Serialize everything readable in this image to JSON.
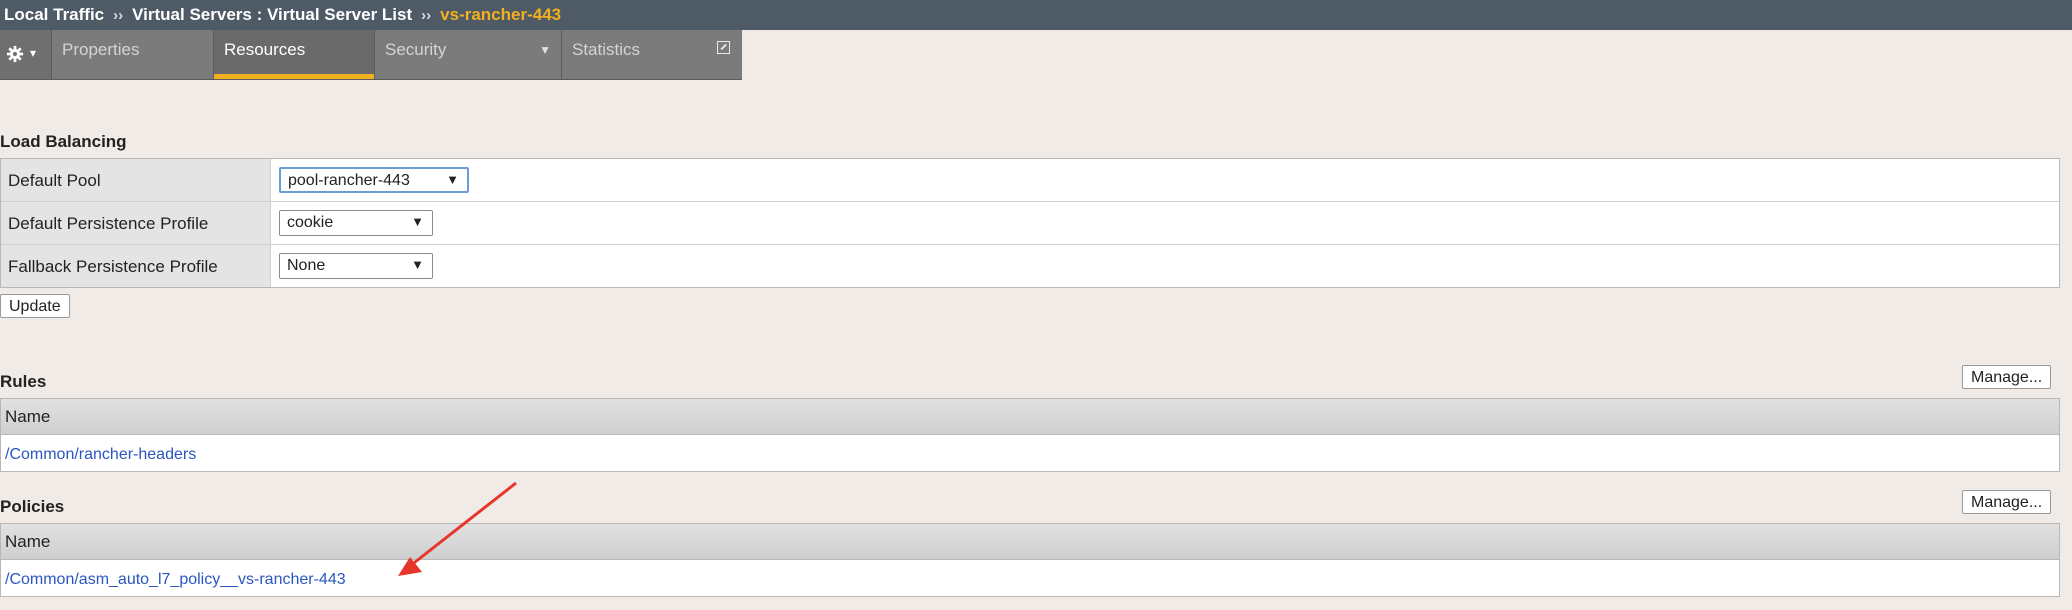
{
  "breadcrumb": {
    "items": [
      "Local Traffic",
      "Virtual Servers : Virtual Server List"
    ],
    "separator": "››",
    "current": "vs-rancher-443"
  },
  "tabs": [
    {
      "label": "Properties",
      "active": false
    },
    {
      "label": "Resources",
      "active": true
    },
    {
      "label": "Security",
      "active": false,
      "dropdown": true
    },
    {
      "label": "Statistics",
      "active": false,
      "popout": true
    }
  ],
  "load_balancing": {
    "title": "Load Balancing",
    "rows": [
      {
        "label": "Default Pool",
        "value": "pool-rancher-443"
      },
      {
        "label": "Default Persistence Profile",
        "value": "cookie"
      },
      {
        "label": "Fallback Persistence Profile",
        "value": "None"
      }
    ],
    "update_label": "Update"
  },
  "rules": {
    "title": "Rules",
    "manage_label": "Manage...",
    "column": "Name",
    "items": [
      "/Common/rancher-headers"
    ]
  },
  "policies": {
    "title": "Policies",
    "manage_label": "Manage...",
    "column": "Name",
    "items": [
      "/Common/asm_auto_l7_policy__vs-rancher-443"
    ]
  },
  "colors": {
    "topbar": "#4e5a66",
    "accent": "#f2b01e",
    "link": "#2b56c0",
    "annotation_arrow": "#e8352b"
  }
}
